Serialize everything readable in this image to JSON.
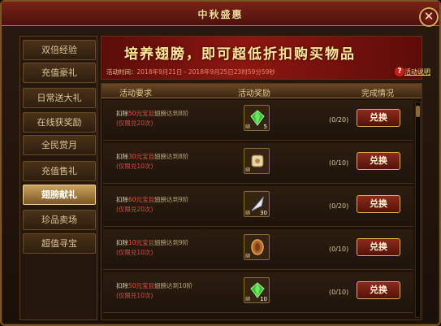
{
  "window": {
    "title": "中秋盛惠"
  },
  "sidebar": {
    "items": [
      {
        "label": "双倍经验"
      },
      {
        "label": "充值豪礼"
      },
      {
        "label": "日常送大礼"
      },
      {
        "label": "在线获奖励"
      },
      {
        "label": "全民赏月"
      },
      {
        "label": "充值售礼"
      },
      {
        "label": "翅膀献礼"
      },
      {
        "label": "珍品卖场"
      },
      {
        "label": "超值寻宝"
      }
    ],
    "active_index": 6
  },
  "banner": {
    "headline": "培养翅膀，即可超低折扣购买物品",
    "time_label": "活动时间：",
    "time_range": "2018年9月21日 - 2018年9月25日23时59分59秒",
    "detail_link": "活动说明"
  },
  "table": {
    "headers": [
      "活动要求",
      "活动奖励",
      "完成情况"
    ],
    "rows": [
      {
        "deduct": "扣除",
        "cost": "50",
        "currency": "元宝且",
        "requirement": "翅膀达到8阶",
        "limit": "(仅限兑20次)",
        "reward_qty": "5",
        "progress": "(0/20)",
        "button": "兑换",
        "reward_icon": "green-gem-icon"
      },
      {
        "deduct": "扣除",
        "cost": "30",
        "currency": "元宝且",
        "requirement": "翅膀达到8阶",
        "limit": "(仅限兑10次)",
        "reward_qty": "",
        "progress": "(0/10)",
        "button": "兑换",
        "reward_icon": "scroll-icon"
      },
      {
        "deduct": "扣除",
        "cost": "60",
        "currency": "元宝且",
        "requirement": "翅膀达到9阶",
        "limit": "(仅限兑20次)",
        "reward_qty": "30",
        "progress": "(0/20)",
        "button": "兑换",
        "reward_icon": "feather-icon"
      },
      {
        "deduct": "扣除",
        "cost": "10",
        "currency": "元宝且",
        "requirement": "翅膀达到9阶",
        "limit": "(仅限兑10次)",
        "reward_qty": "",
        "progress": "(0/10)",
        "button": "兑换",
        "reward_icon": "bronze-medal-icon"
      },
      {
        "deduct": "扣除",
        "cost": "50",
        "currency": "元宝且",
        "requirement": "翅膀达到10阶",
        "limit": "(仅限兑10次)",
        "reward_qty": "10",
        "progress": "(0/10)",
        "button": "兑换",
        "reward_icon": "green-gem-icon"
      }
    ]
  }
}
